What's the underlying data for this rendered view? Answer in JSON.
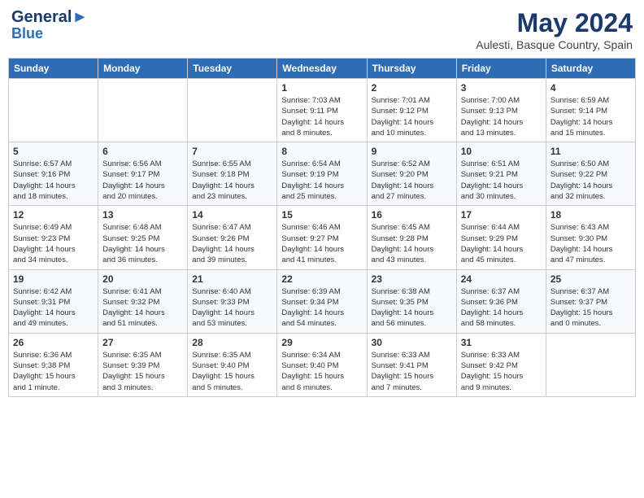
{
  "header": {
    "logo_line1": "General",
    "logo_line2": "Blue",
    "month_year": "May 2024",
    "location": "Aulesti, Basque Country, Spain"
  },
  "days_of_week": [
    "Sunday",
    "Monday",
    "Tuesday",
    "Wednesday",
    "Thursday",
    "Friday",
    "Saturday"
  ],
  "weeks": [
    [
      {
        "day": "",
        "info": ""
      },
      {
        "day": "",
        "info": ""
      },
      {
        "day": "",
        "info": ""
      },
      {
        "day": "1",
        "info": "Sunrise: 7:03 AM\nSunset: 9:11 PM\nDaylight: 14 hours\nand 8 minutes."
      },
      {
        "day": "2",
        "info": "Sunrise: 7:01 AM\nSunset: 9:12 PM\nDaylight: 14 hours\nand 10 minutes."
      },
      {
        "day": "3",
        "info": "Sunrise: 7:00 AM\nSunset: 9:13 PM\nDaylight: 14 hours\nand 13 minutes."
      },
      {
        "day": "4",
        "info": "Sunrise: 6:59 AM\nSunset: 9:14 PM\nDaylight: 14 hours\nand 15 minutes."
      }
    ],
    [
      {
        "day": "5",
        "info": "Sunrise: 6:57 AM\nSunset: 9:16 PM\nDaylight: 14 hours\nand 18 minutes."
      },
      {
        "day": "6",
        "info": "Sunrise: 6:56 AM\nSunset: 9:17 PM\nDaylight: 14 hours\nand 20 minutes."
      },
      {
        "day": "7",
        "info": "Sunrise: 6:55 AM\nSunset: 9:18 PM\nDaylight: 14 hours\nand 23 minutes."
      },
      {
        "day": "8",
        "info": "Sunrise: 6:54 AM\nSunset: 9:19 PM\nDaylight: 14 hours\nand 25 minutes."
      },
      {
        "day": "9",
        "info": "Sunrise: 6:52 AM\nSunset: 9:20 PM\nDaylight: 14 hours\nand 27 minutes."
      },
      {
        "day": "10",
        "info": "Sunrise: 6:51 AM\nSunset: 9:21 PM\nDaylight: 14 hours\nand 30 minutes."
      },
      {
        "day": "11",
        "info": "Sunrise: 6:50 AM\nSunset: 9:22 PM\nDaylight: 14 hours\nand 32 minutes."
      }
    ],
    [
      {
        "day": "12",
        "info": "Sunrise: 6:49 AM\nSunset: 9:23 PM\nDaylight: 14 hours\nand 34 minutes."
      },
      {
        "day": "13",
        "info": "Sunrise: 6:48 AM\nSunset: 9:25 PM\nDaylight: 14 hours\nand 36 minutes."
      },
      {
        "day": "14",
        "info": "Sunrise: 6:47 AM\nSunset: 9:26 PM\nDaylight: 14 hours\nand 39 minutes."
      },
      {
        "day": "15",
        "info": "Sunrise: 6:46 AM\nSunset: 9:27 PM\nDaylight: 14 hours\nand 41 minutes."
      },
      {
        "day": "16",
        "info": "Sunrise: 6:45 AM\nSunset: 9:28 PM\nDaylight: 14 hours\nand 43 minutes."
      },
      {
        "day": "17",
        "info": "Sunrise: 6:44 AM\nSunset: 9:29 PM\nDaylight: 14 hours\nand 45 minutes."
      },
      {
        "day": "18",
        "info": "Sunrise: 6:43 AM\nSunset: 9:30 PM\nDaylight: 14 hours\nand 47 minutes."
      }
    ],
    [
      {
        "day": "19",
        "info": "Sunrise: 6:42 AM\nSunset: 9:31 PM\nDaylight: 14 hours\nand 49 minutes."
      },
      {
        "day": "20",
        "info": "Sunrise: 6:41 AM\nSunset: 9:32 PM\nDaylight: 14 hours\nand 51 minutes."
      },
      {
        "day": "21",
        "info": "Sunrise: 6:40 AM\nSunset: 9:33 PM\nDaylight: 14 hours\nand 53 minutes."
      },
      {
        "day": "22",
        "info": "Sunrise: 6:39 AM\nSunset: 9:34 PM\nDaylight: 14 hours\nand 54 minutes."
      },
      {
        "day": "23",
        "info": "Sunrise: 6:38 AM\nSunset: 9:35 PM\nDaylight: 14 hours\nand 56 minutes."
      },
      {
        "day": "24",
        "info": "Sunrise: 6:37 AM\nSunset: 9:36 PM\nDaylight: 14 hours\nand 58 minutes."
      },
      {
        "day": "25",
        "info": "Sunrise: 6:37 AM\nSunset: 9:37 PM\nDaylight: 15 hours\nand 0 minutes."
      }
    ],
    [
      {
        "day": "26",
        "info": "Sunrise: 6:36 AM\nSunset: 9:38 PM\nDaylight: 15 hours\nand 1 minute."
      },
      {
        "day": "27",
        "info": "Sunrise: 6:35 AM\nSunset: 9:39 PM\nDaylight: 15 hours\nand 3 minutes."
      },
      {
        "day": "28",
        "info": "Sunrise: 6:35 AM\nSunset: 9:40 PM\nDaylight: 15 hours\nand 5 minutes."
      },
      {
        "day": "29",
        "info": "Sunrise: 6:34 AM\nSunset: 9:40 PM\nDaylight: 15 hours\nand 6 minutes."
      },
      {
        "day": "30",
        "info": "Sunrise: 6:33 AM\nSunset: 9:41 PM\nDaylight: 15 hours\nand 7 minutes."
      },
      {
        "day": "31",
        "info": "Sunrise: 6:33 AM\nSunset: 9:42 PM\nDaylight: 15 hours\nand 9 minutes."
      },
      {
        "day": "",
        "info": ""
      }
    ]
  ]
}
